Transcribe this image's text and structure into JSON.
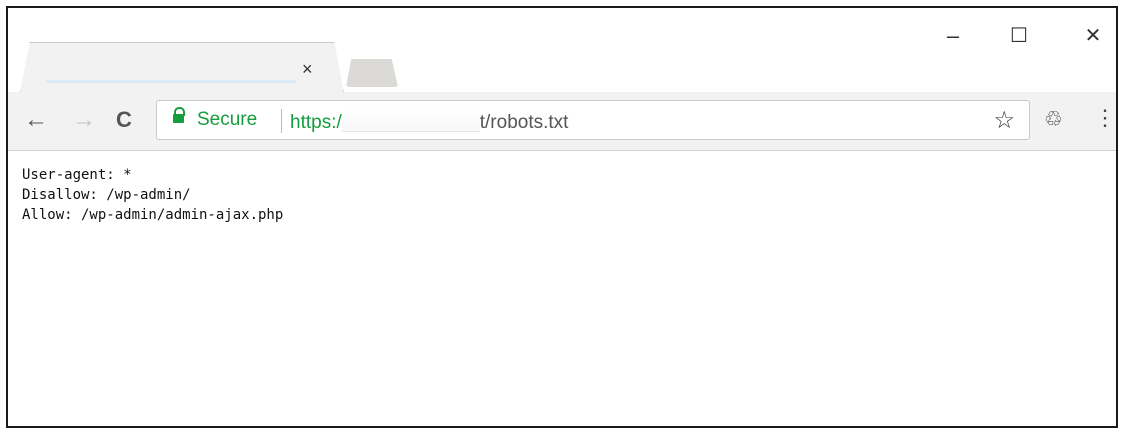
{
  "window": {
    "minimize_glyph": "–",
    "maximize_glyph": "☐",
    "close_glyph": "✕"
  },
  "tab": {
    "title": "",
    "close_glyph": "×"
  },
  "toolbar": {
    "back_glyph": "←",
    "forward_glyph": "→",
    "reload_glyph": "C",
    "secure_label": "Secure",
    "url_scheme": "https:/",
    "url_host": "",
    "url_path": "t/robots.txt",
    "bookmark_glyph": "☆",
    "extension_glyph": "♲",
    "menu_glyph": "⋮"
  },
  "page": {
    "lines": [
      "User-agent: *",
      "Disallow: /wp-admin/",
      "Allow: /wp-admin/admin-ajax.php"
    ]
  },
  "colors": {
    "secure_green": "#149e3d",
    "toolbar_bg": "#f2f2f2"
  }
}
